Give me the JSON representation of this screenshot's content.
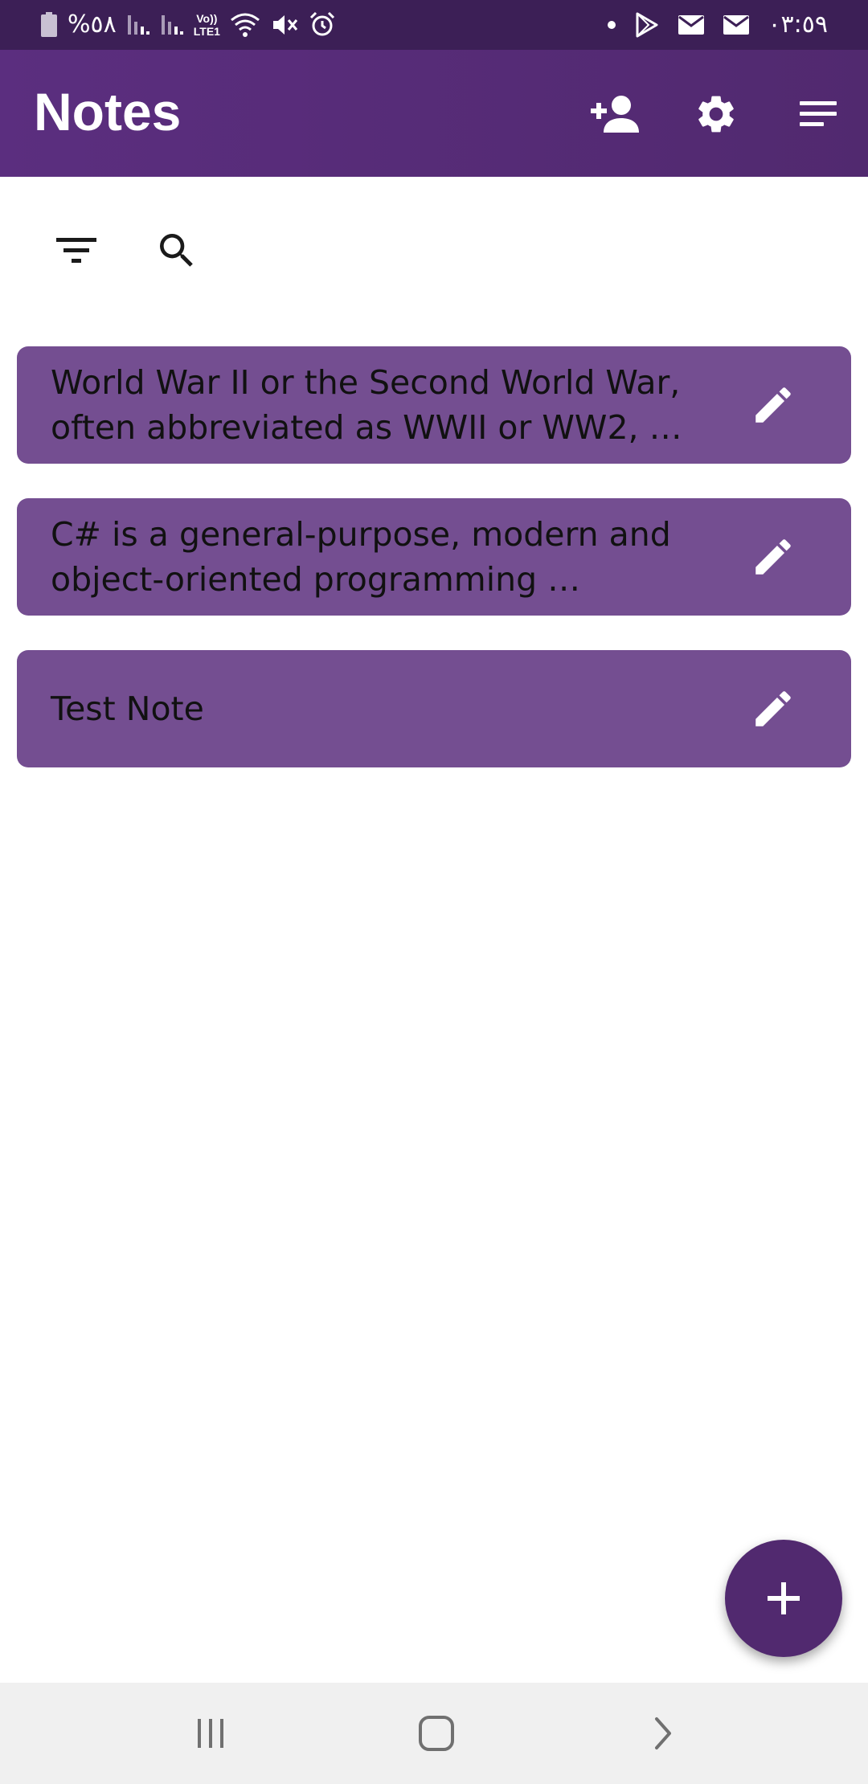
{
  "status_bar": {
    "battery_text": "%٥٨",
    "network_label_top": "Vo))",
    "network_label_bottom": "LTE1",
    "time": "٠٣:٥٩",
    "icons": [
      "battery-icon",
      "signal-icon",
      "signal-icon",
      "wifi-icon",
      "mute-icon",
      "alarm-icon",
      "dot-icon",
      "play-store-icon",
      "mail-icon",
      "mail-icon"
    ]
  },
  "app_bar": {
    "title": "Notes",
    "actions": [
      "add-user-icon",
      "gear-icon",
      "sort-icon"
    ]
  },
  "toolbar": {
    "icons": [
      "filter-icon",
      "search-icon"
    ]
  },
  "notes": [
    {
      "line1": "World War II or the Second World War,",
      "line2": "often abbreviated as WWII or WW2, …"
    },
    {
      "line1": "C# is a general-purpose, modern and",
      "line2": "object-oriented programming …"
    },
    {
      "line1": "Test Note"
    }
  ],
  "fab": {
    "icon": "plus-icon"
  },
  "nav_bar": {
    "icons": [
      "recent-apps-icon",
      "home-icon",
      "back-icon"
    ]
  },
  "colors": {
    "status_bar": "#3c1f56",
    "app_bar": "#542b74",
    "note_card": "#744e91",
    "fab": "#51296f",
    "nav_bar": "#f0f0f0"
  }
}
